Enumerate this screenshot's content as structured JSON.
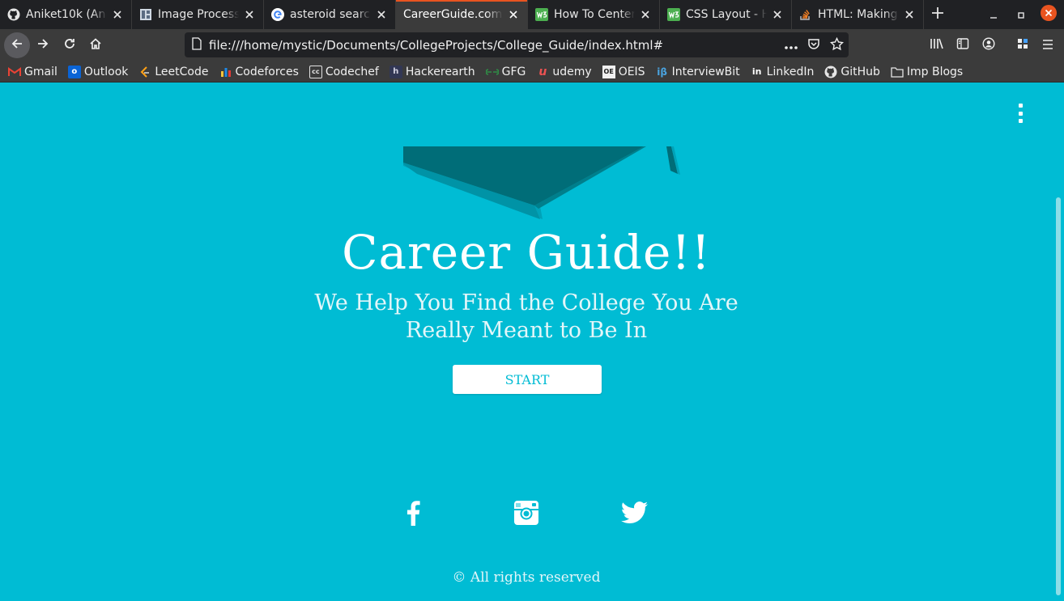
{
  "browser": {
    "tabs": [
      {
        "label": "Aniket10k (Anik",
        "icon": "github-icon"
      },
      {
        "label": "Image Processin",
        "icon": "document-icon"
      },
      {
        "label": "asteroid search",
        "icon": "google-icon"
      },
      {
        "label": "CareerGuide.com",
        "icon": "none",
        "active": true
      },
      {
        "label": "How To Center",
        "icon": "w3schools-icon"
      },
      {
        "label": "CSS Layout - Ho",
        "icon": "w3schools-icon"
      },
      {
        "label": "HTML: Making a",
        "icon": "stackoverflow-icon"
      }
    ],
    "url": "file:///home/mystic/Documents/CollegeProjects/College_Guide/index.html#",
    "bookmarks": [
      {
        "label": "Gmail",
        "icon": "gmail-icon"
      },
      {
        "label": "Outlook",
        "icon": "outlook-icon"
      },
      {
        "label": "LeetCode",
        "icon": "leetcode-icon"
      },
      {
        "label": "Codeforces",
        "icon": "codeforces-icon"
      },
      {
        "label": "Codechef",
        "icon": "codechef-icon"
      },
      {
        "label": "Hackerearth",
        "icon": "hackerearth-icon"
      },
      {
        "label": "GFG",
        "icon": "gfg-icon"
      },
      {
        "label": "udemy",
        "icon": "udemy-icon"
      },
      {
        "label": "OEIS",
        "icon": "oeis-icon"
      },
      {
        "label": "InterviewBit",
        "icon": "interviewbit-icon"
      },
      {
        "label": "LinkedIn",
        "icon": "linkedin-icon"
      },
      {
        "label": "GitHub",
        "icon": "github-icon"
      },
      {
        "label": "Imp Blogs",
        "icon": "folder-icon"
      }
    ],
    "colors": {
      "tab_bg": "#202124",
      "toolbar_bg": "#3b3b3b",
      "active_tab_accent": "#e95420",
      "close_button": "#e95420"
    }
  },
  "page": {
    "title": "Career Guide!!",
    "subtitle_line1": "We Help You Find the College You Are",
    "subtitle_line2": "Really Meant to Be In",
    "start_label": "START",
    "social": [
      "facebook-icon",
      "instagram-icon",
      "twitter-icon"
    ],
    "copyright": "© All rights reserved",
    "colors": {
      "background": "#00bcd4",
      "cap_dark": "#006d78",
      "cap_mid": "#00a2b8",
      "button_text": "#00bcd4"
    }
  }
}
